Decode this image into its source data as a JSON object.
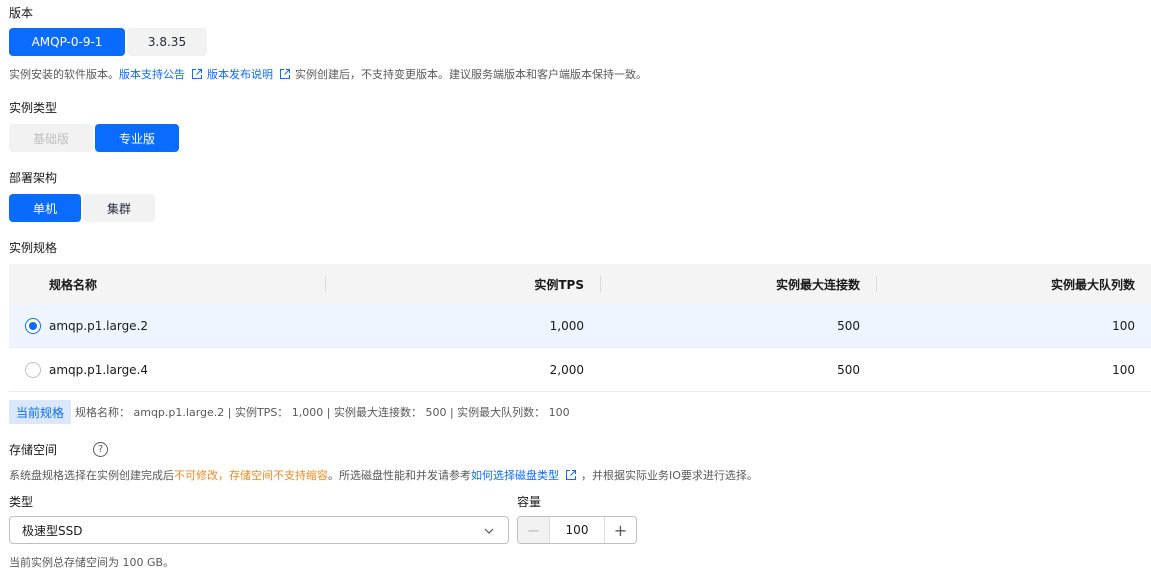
{
  "version": {
    "label": "版本",
    "options": [
      "AMQP-0-9-1",
      "3.8.35"
    ],
    "selected": "AMQP-0-9-1",
    "hint_prefix": "实例安装的软件版本。",
    "link1": "版本支持公告",
    "link2": "版本发布说明",
    "hint_suffix": "实例创建后，不支持变更版本。建议服务端版本和客户端版本保持一致。"
  },
  "instance_type": {
    "label": "实例类型",
    "options": [
      "基础版",
      "专业版"
    ],
    "selected": "专业版"
  },
  "deployment": {
    "label": "部署架构",
    "options": [
      "单机",
      "集群"
    ],
    "selected": "单机"
  },
  "spec": {
    "label": "实例规格",
    "columns": [
      "规格名称",
      "实例TPS",
      "实例最大连接数",
      "实例最大队列数"
    ],
    "rows": [
      {
        "name": "amqp.p1.large.2",
        "tps": "1,000",
        "max_conn": "500",
        "max_queue": "100",
        "selected": true
      },
      {
        "name": "amqp.p1.large.4",
        "tps": "2,000",
        "max_conn": "500",
        "max_queue": "100",
        "selected": false
      }
    ],
    "current_tag": "当前规格",
    "current_text": "规格名称： amqp.p1.large.2 | 实例TPS： 1,000 | 实例最大连接数： 500 | 实例最大队列数： 100"
  },
  "storage": {
    "label": "存储空间",
    "hint_prefix": "系统盘规格选择在实例创建完成后",
    "warn1": "不可修改",
    "warn_sep": "，",
    "warn2": "存储空间不支持缩容",
    "hint_mid": "。所选磁盘性能和并发请参考",
    "link": "如何选择磁盘类型",
    "hint_suffix": "，并根据实际业务IO要求进行选择。",
    "type_label": "类型",
    "type_value": "极速型SSD",
    "capacity_label": "容量",
    "capacity_value": "100",
    "total_text": "当前实例总存储空间为 100 GB。"
  },
  "colors": {
    "accent": "#0a6cff",
    "warning": "#f6891f"
  }
}
